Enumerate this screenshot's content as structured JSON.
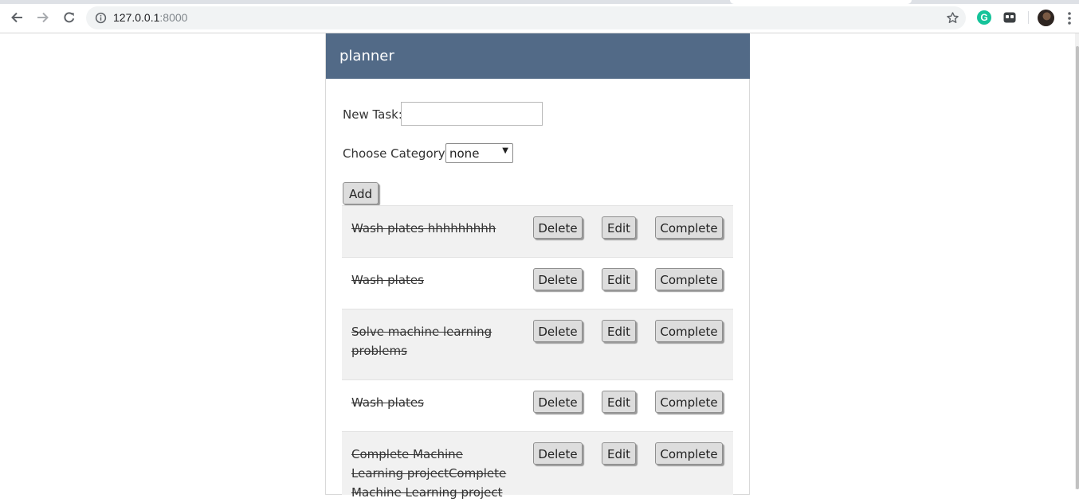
{
  "browser": {
    "url_host": "127.0.0.1",
    "url_port": ":8000",
    "back_icon": "arrow-left-icon",
    "forward_icon": "arrow-right-icon",
    "reload_icon": "reload-icon",
    "info_icon": "info-icon",
    "bookmark_icon": "star-icon",
    "extensions": [
      "grammarly-icon",
      "extension-icon"
    ],
    "grammarly_letter": "G",
    "menu_icon": "kebab-menu-icon"
  },
  "app": {
    "title": "planner",
    "header_color": "#526a87"
  },
  "form": {
    "new_task_label": "New Task:",
    "new_task_value": "",
    "category_label": "Choose Category:",
    "category_selected": "none",
    "add_label": "Add"
  },
  "tasks": [
    {
      "text": "Wash plates hhhhhhhhh",
      "completed": true,
      "delete_label": "Delete",
      "edit_label": "Edit",
      "complete_label": "Complete"
    },
    {
      "text": "Wash plates",
      "completed": true,
      "delete_label": "Delete",
      "edit_label": "Edit",
      "complete_label": "Complete"
    },
    {
      "text": "Solve machine learning problems",
      "completed": true,
      "delete_label": "Delete",
      "edit_label": "Edit",
      "complete_label": "Complete"
    },
    {
      "text": "Wash plates",
      "completed": true,
      "delete_label": "Delete",
      "edit_label": "Edit",
      "complete_label": "Complete"
    },
    {
      "text": "Complete Machine Learning projectComplete Machine Learning project",
      "completed": true,
      "delete_label": "Delete",
      "edit_label": "Edit",
      "complete_label": "Complete"
    }
  ]
}
